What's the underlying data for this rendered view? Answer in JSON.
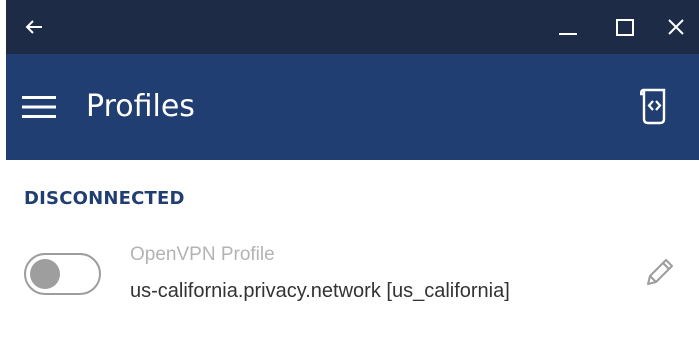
{
  "window": {
    "back_icon": "arrow-left-icon",
    "minimize_icon": "minimize-icon",
    "maximize_icon": "maximize-icon",
    "close_icon": "close-icon",
    "titlebar_color": "#1d2b47"
  },
  "header": {
    "title": "Profiles",
    "menu_icon": "hamburger-menu-icon",
    "export_icon": "export-logs-icon",
    "header_color": "#203e72"
  },
  "connection": {
    "status": "DISCONNECTED",
    "status_color": "#203e72"
  },
  "profile": {
    "type": "OpenVPN Profile",
    "server": "us-california.privacy.network [us_california]",
    "connected": false,
    "edit_icon": "pencil-icon"
  }
}
